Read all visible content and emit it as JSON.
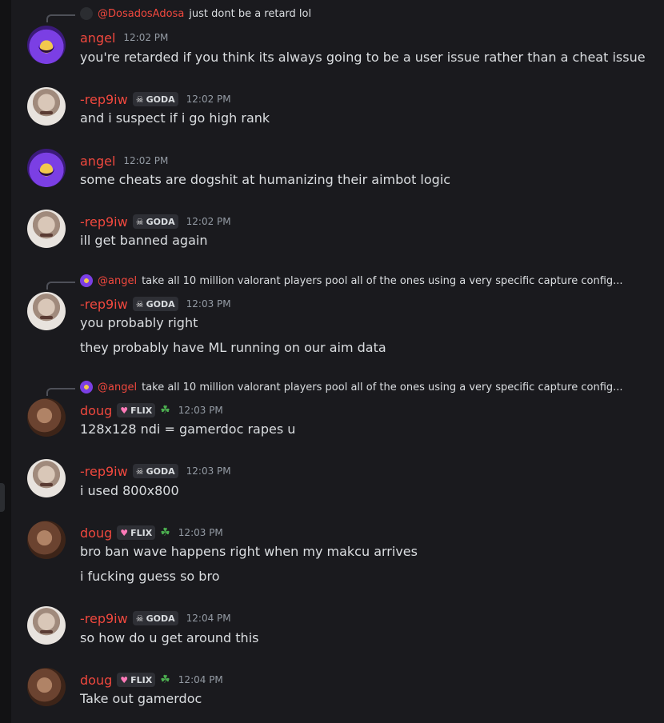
{
  "messages": [
    {
      "reply": {
        "name": "@DosadosAdosa",
        "text": "just dont be a retard lol",
        "avatar": "dark"
      },
      "user": "angel",
      "time": "12:02 PM",
      "avatar": "angel",
      "lines": [
        "you're retarded if you think its always going to be a user issue rather than a cheat issue"
      ]
    },
    {
      "user": "-rep9iw",
      "tag": "GODA",
      "tag_icon": "skull-icon",
      "time": "12:02 PM",
      "avatar": "rep",
      "lines": [
        "and i suspect if i go high rank"
      ]
    },
    {
      "user": "angel",
      "time": "12:02 PM",
      "avatar": "angel",
      "lines": [
        "some cheats are dogshit at humanizing their aimbot logic"
      ]
    },
    {
      "user": "-rep9iw",
      "tag": "GODA",
      "tag_icon": "skull-icon",
      "time": "12:02 PM",
      "avatar": "rep",
      "lines": [
        "ill get banned again"
      ]
    },
    {
      "reply": {
        "name": "@angel",
        "text": "take all 10 million valorant players  pool all of the ones using a very specific capture config...",
        "avatar": "angel"
      },
      "user": "-rep9iw",
      "tag": "GODA",
      "tag_icon": "skull-icon",
      "time": "12:03 PM",
      "avatar": "rep",
      "lines": [
        "you probably right",
        "they probably have ML running on our aim data"
      ]
    },
    {
      "reply": {
        "name": "@angel",
        "text": "take all 10 million valorant players  pool all of the ones using a very specific capture config...",
        "avatar": "angel"
      },
      "user": "doug",
      "tag": "FLIX",
      "tag_icon": "heart-icon",
      "leaf": true,
      "time": "12:03 PM",
      "avatar": "doug",
      "lines": [
        "128x128 ndi = gamerdoc rapes u"
      ]
    },
    {
      "user": "-rep9iw",
      "tag": "GODA",
      "tag_icon": "skull-icon",
      "time": "12:03 PM",
      "avatar": "rep",
      "lines": [
        "i used 800x800"
      ]
    },
    {
      "user": "doug",
      "tag": "FLIX",
      "tag_icon": "heart-icon",
      "leaf": true,
      "time": "12:03 PM",
      "avatar": "doug",
      "lines": [
        "bro ban wave happens right when my makcu arrives",
        "i fucking guess so bro"
      ]
    },
    {
      "user": "-rep9iw",
      "tag": "GODA",
      "tag_icon": "skull-icon",
      "time": "12:04 PM",
      "avatar": "rep",
      "lines": [
        "so how do u get around this"
      ]
    },
    {
      "user": "doug",
      "tag": "FLIX",
      "tag_icon": "heart-icon",
      "leaf": true,
      "time": "12:04 PM",
      "avatar": "doug",
      "lines": [
        "Take out gamerdoc"
      ]
    }
  ]
}
